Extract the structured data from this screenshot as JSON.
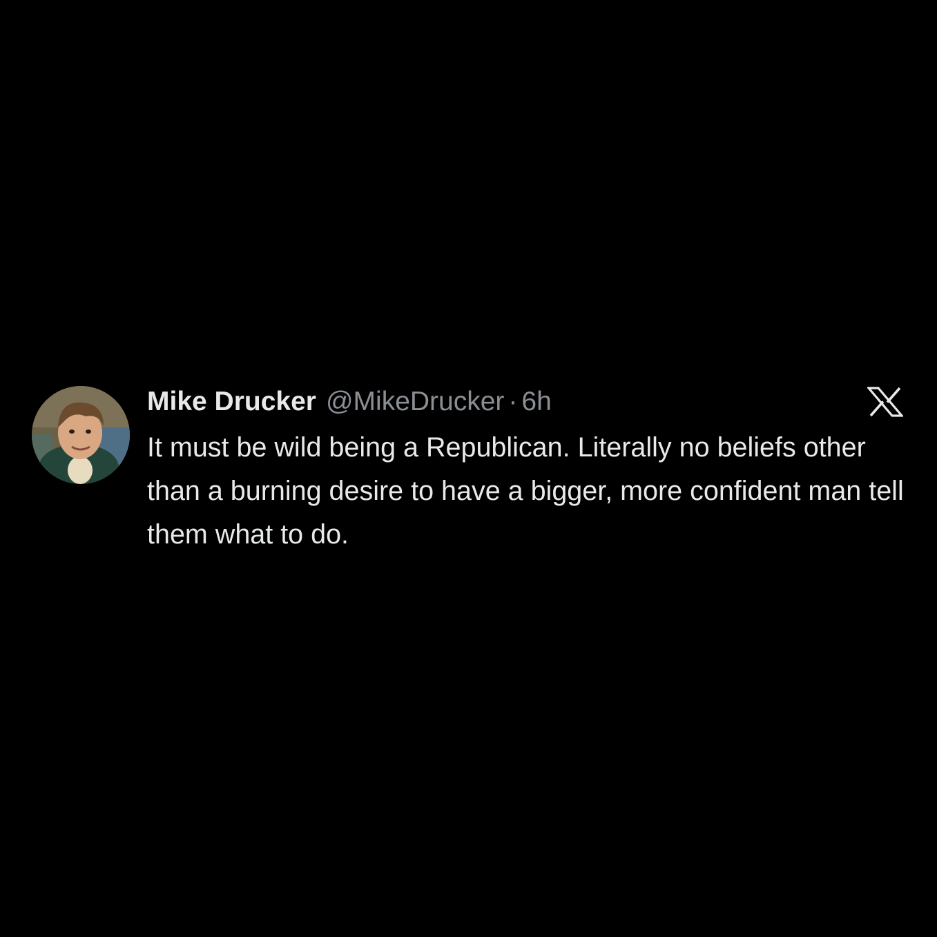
{
  "tweet": {
    "display_name": "Mike Drucker",
    "handle": "@MikeDrucker",
    "separator": "·",
    "time": "6h",
    "text": "It must be wild being a Republican. Literally no beliefs other than a burning desire to have a bigger, more confident man tell them what to do."
  },
  "icons": {
    "avatar": "avatar-photo",
    "platform": "x-logo-icon"
  },
  "colors": {
    "background": "#000000",
    "primary_text": "#e7e9ea",
    "secondary_text": "#8b8f94"
  }
}
